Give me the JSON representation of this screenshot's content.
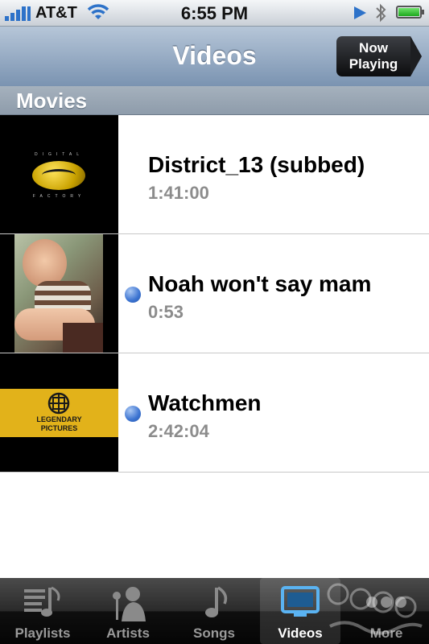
{
  "status": {
    "carrier": "AT&T",
    "time": "6:55 PM"
  },
  "nav": {
    "title": "Videos",
    "now_playing_line1": "Now",
    "now_playing_line2": "Playing"
  },
  "section": {
    "title": "Movies"
  },
  "videos": [
    {
      "title": "District_13 (subbed)",
      "duration": "1:41:00",
      "unwatched": false
    },
    {
      "title": "Noah won't say mam",
      "duration": "0:53",
      "unwatched": true
    },
    {
      "title": "Watchmen",
      "duration": "2:42:04",
      "unwatched": true
    }
  ],
  "thumbs": {
    "digital_factory_top": "DIGITAL",
    "digital_factory_bottom": "FACTORY",
    "legendary_line1": "LEGENDARY",
    "legendary_line2": "PICTURES"
  },
  "tabs": [
    {
      "label": "Playlists",
      "icon": "playlists-icon",
      "active": false
    },
    {
      "label": "Artists",
      "icon": "artists-icon",
      "active": false
    },
    {
      "label": "Songs",
      "icon": "songs-icon",
      "active": false
    },
    {
      "label": "Videos",
      "icon": "videos-icon",
      "active": true
    },
    {
      "label": "More",
      "icon": "more-icon",
      "active": false
    }
  ],
  "colors": {
    "accent_blue": "#2d72c9",
    "unwatched_dot": "#3b73d1",
    "watermark": "#ffffff"
  }
}
